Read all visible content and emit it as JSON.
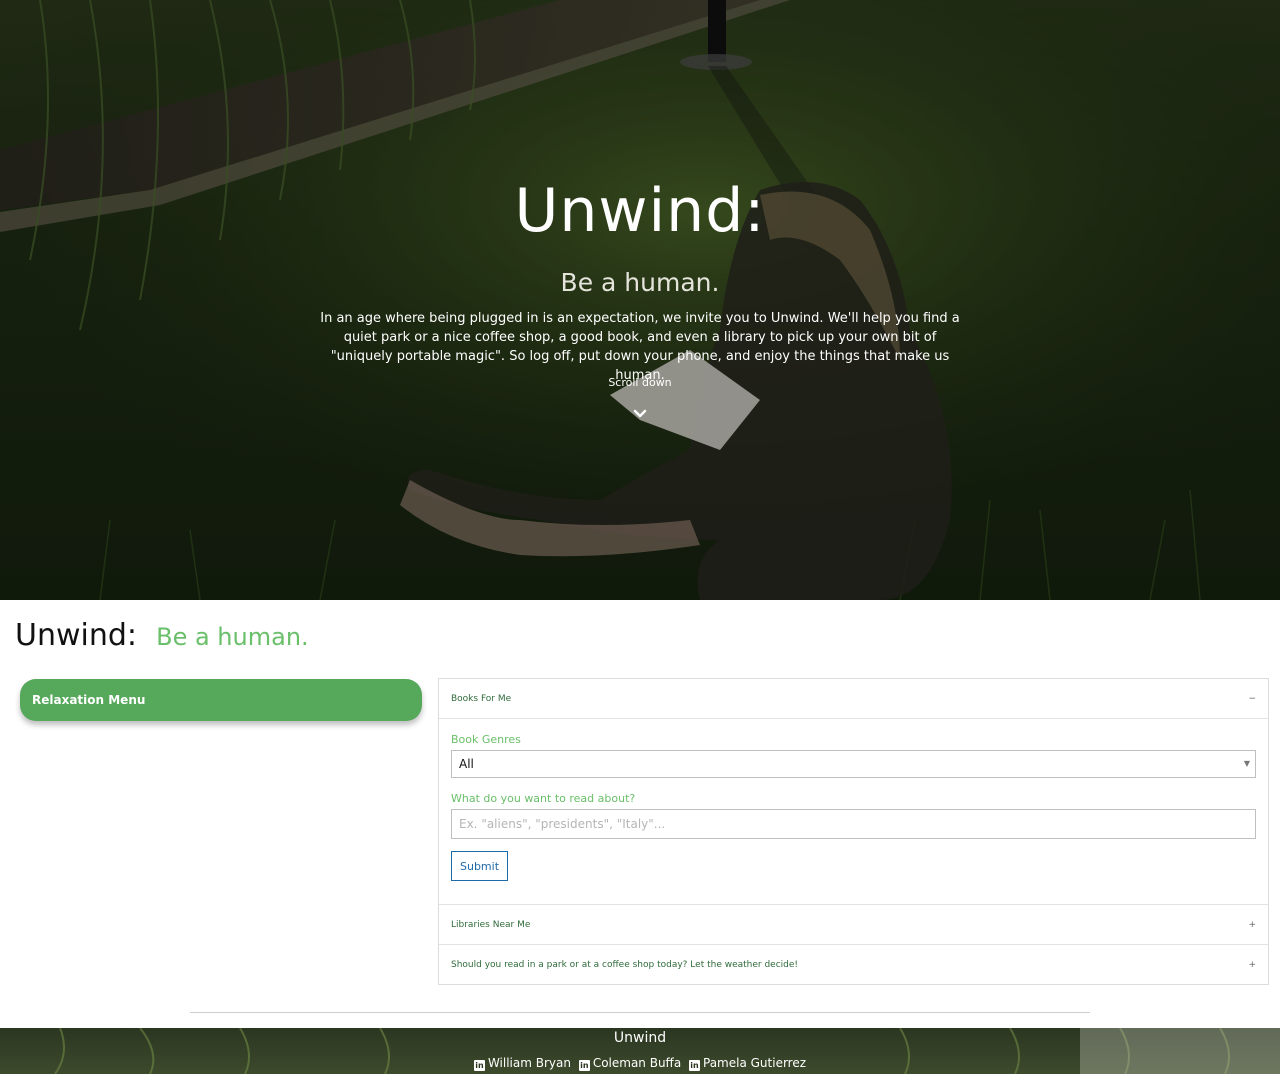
{
  "hero": {
    "title": "Unwind:",
    "subtitle": "Be a human.",
    "description": "In an age where being plugged in is an expectation, we invite you to Unwind. We'll help you find a quiet park or a nice coffee shop, a good book, and even a library to pick up your own bit of \"uniquely portable magic\". So log off, put down your phone, and enjoy the things that make us human.",
    "scroll_label": "Scroll down",
    "scroll_icon": "chevron-down-icon"
  },
  "header": {
    "brand": "Unwind:",
    "tagline": "Be a human."
  },
  "sidebar": {
    "menu_label": "Relaxation Menu"
  },
  "accordion": {
    "sections": [
      {
        "label": "Books For Me",
        "toggle": "−",
        "expanded": true
      },
      {
        "label": "Libraries Near Me",
        "toggle": "+",
        "expanded": false
      },
      {
        "label": "Should you read in a park or at a coffee shop today? Let the weather decide!",
        "toggle": "+",
        "expanded": false
      }
    ],
    "books_form": {
      "genre_label": "Book Genres",
      "genre_selected": "All",
      "topic_label": "What do you want to read about?",
      "topic_placeholder": "Ex. \"aliens\", \"presidents\", \"Italy\"...",
      "topic_value": "",
      "submit_label": "Submit"
    }
  },
  "footer": {
    "title": "Unwind",
    "credits": [
      {
        "icon": "linkedin-icon",
        "name": "William Bryan"
      },
      {
        "icon": "linkedin-icon",
        "name": "Coleman Buffa"
      },
      {
        "icon": "linkedin-icon",
        "name": "Pamela Gutierrez"
      }
    ]
  },
  "colors": {
    "accent_green": "#56a85a",
    "tagline_green": "#6abf6a",
    "submit_blue": "#1f6aa8"
  }
}
